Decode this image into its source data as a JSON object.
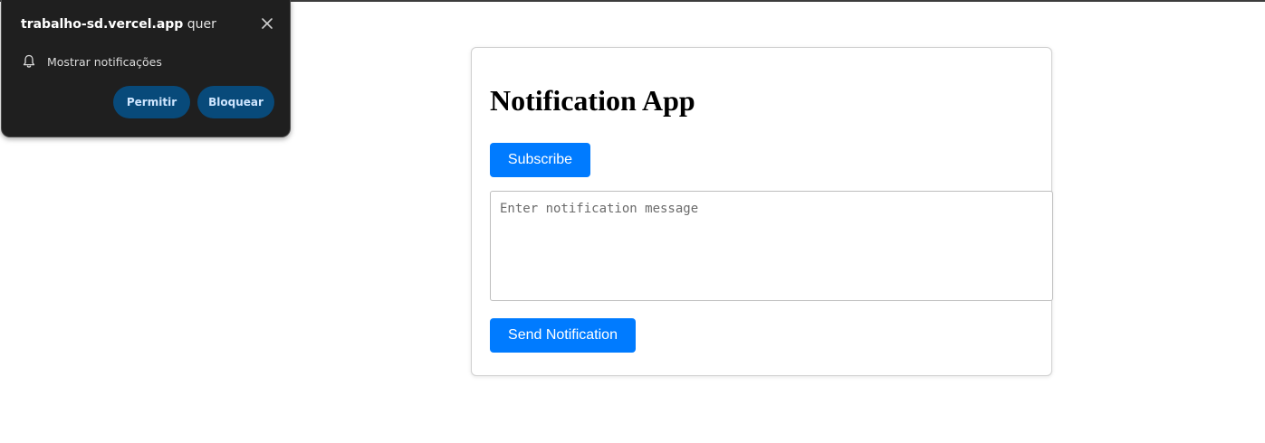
{
  "permission_prompt": {
    "site": "trabalho-sd.vercel.app",
    "suffix": " quer",
    "permission_label": "Mostrar notificações",
    "allow_label": "Permitir",
    "block_label": "Bloquear",
    "icons": {
      "close": "close-icon",
      "bell": "bell-icon"
    }
  },
  "app": {
    "title": "Notification App",
    "subscribe_label": "Subscribe",
    "message": {
      "value": "",
      "placeholder": "Enter notification message"
    },
    "send_label": "Send Notification"
  },
  "colors": {
    "primary": "#007bff",
    "popup_bg": "#1f1f1f",
    "popup_button": "#084a7a"
  }
}
